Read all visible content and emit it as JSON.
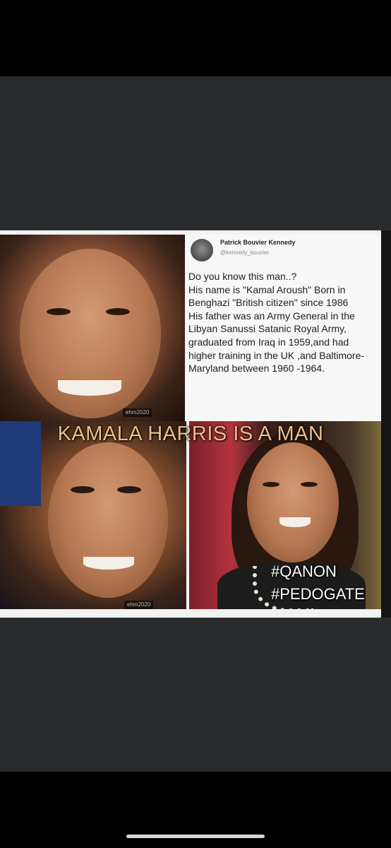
{
  "tweet": {
    "author_name": "Patrick Bouvier Kennedy",
    "author_handle": "@kennedy_bouvier",
    "body": "Do you know this man..?\nHis name is \"Kamal Aroush\" Born in Benghazi \"British citizen\" since 1986\nHis father was an Army General in the Libyan Sanussi Satanic Royal Army, graduated from Iraq in 1959,and had higher training in the UK ,and Baltimore-Maryland between 1960 -1964."
  },
  "headline": "KAMALA HARRIS IS A MAN",
  "hashtags": [
    "#QANON",
    "#PEDOGATE"
  ],
  "watermarks": [
    "ehm2020",
    "ehm2020"
  ],
  "colors": {
    "headline": "#e9c08a",
    "viewer_background": "#2a2b2d",
    "status_bar": "#000000"
  }
}
